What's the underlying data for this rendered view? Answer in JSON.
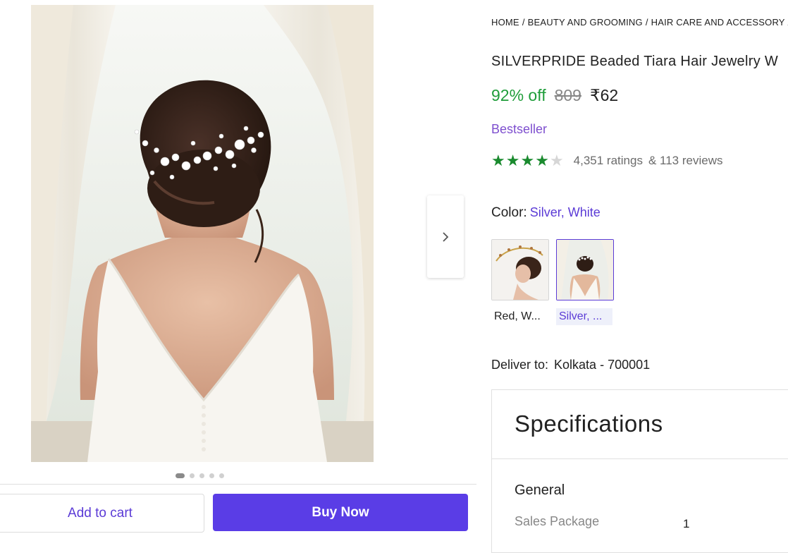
{
  "breadcrumb": [
    "HOME",
    "BEAUTY AND GROOMING",
    "HAIR CARE AND ACCESSORY",
    ""
  ],
  "product": {
    "title": "SILVERPRIDE Beaded Tiara Hair Jewelry W",
    "discount": "92% off",
    "mrp": "809",
    "price": "₹62",
    "badge": "Bestseller",
    "rating": 4,
    "rating_max": 5,
    "ratings_text": "4,351 ratings",
    "reviews_text": "& 113 reviews"
  },
  "carousel": {
    "count": 5,
    "active": 1
  },
  "color": {
    "label": "Color:",
    "value": "Silver, White",
    "options": [
      {
        "label": "Red, W...",
        "selected": false
      },
      {
        "label": "Silver, ...",
        "selected": true
      }
    ]
  },
  "delivery": {
    "label": "Deliver to:",
    "location": "Kolkata - 700001"
  },
  "specifications": {
    "title": "Specifications",
    "section": "General",
    "rows": [
      {
        "key": "Sales Package",
        "value": "1"
      }
    ]
  },
  "actions": {
    "add_to_cart": "Add to cart",
    "buy_now": "Buy Now"
  },
  "colors": {
    "accent": "#5a3de6",
    "discount": "#1f9d3a",
    "star": "#1a8a2e",
    "badge": "#7e4fcf"
  },
  "icons": {
    "next": "chevron-right-icon",
    "star": "star-icon"
  }
}
